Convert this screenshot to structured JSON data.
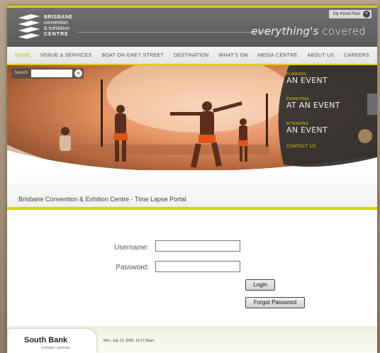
{
  "header": {
    "logo_lines": [
      "BRISBANE",
      "convention",
      "& exhibition",
      "CENTRE"
    ],
    "tagline_prefix": "everything's",
    "tagline_suffix": " covered",
    "kiosk_label": "My Kiosk Plan",
    "kiosk_close": "×"
  },
  "nav": {
    "items": [
      {
        "label": "HOME",
        "active": true
      },
      {
        "label": "VENUE & SERVICES"
      },
      {
        "label": "BOAT ON GREY STREET"
      },
      {
        "label": "DESTINATION"
      },
      {
        "label": "WHAT'S ON"
      },
      {
        "label": "MEDIA CENTRE"
      },
      {
        "label": "ABOUT US"
      },
      {
        "label": "CAREERS"
      }
    ]
  },
  "search": {
    "label": "Search",
    "go": "»",
    "placeholder": ""
  },
  "events": {
    "planning_small": "PLANNING",
    "planning_big": "AN EVENT",
    "exhibiting_small": "EXHIBITING",
    "exhibiting_big": "AT AN EVENT",
    "attending_small": "ATTENDING",
    "attending_big": "AN EVENT",
    "contact": "CONTACT US"
  },
  "page": {
    "title": "Brisbane Convention & Exhition Centre - Time Lapse Portal"
  },
  "login": {
    "username_label": "Username:",
    "password_label": "Password:",
    "username_value": "",
    "password_value": "",
    "login_button": "Login",
    "forgot_button": "Forgot Password"
  },
  "footer": {
    "brand": "South Bank",
    "sub": "brisbane, australia",
    "timestamp": "Mon, July 13, 2009, 10:17:36am"
  },
  "colors": {
    "accent": "#d9d200",
    "header_bg": "#646464"
  }
}
